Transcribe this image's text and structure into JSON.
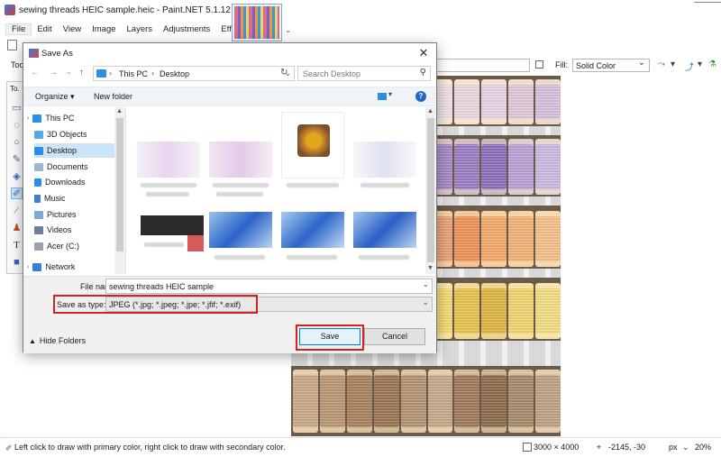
{
  "app": {
    "title": "sewing threads HEIC sample.heic - Paint.NET 5.1.12",
    "menu": [
      "File",
      "Edit",
      "View",
      "Image",
      "Layers",
      "Adjustments",
      "Effects"
    ],
    "tool_label": "Too",
    "fill_label": "Fill:",
    "fill_value": "Solid Color",
    "toolbox_label": "To."
  },
  "status": {
    "hint": "Left click to draw with primary color, right click to draw with secondary color.",
    "image_size": "3000 × 4000",
    "cursor_pos": "-2145, -30",
    "unit": "px",
    "zoom": "20%"
  },
  "dialog": {
    "title": "Save As",
    "breadcrumb": [
      "This PC",
      "Desktop"
    ],
    "search_placeholder": "Search Desktop",
    "organize_label": "Organize",
    "new_folder_label": "New folder",
    "nav_items": [
      {
        "label": "This PC",
        "icon": "computer-icon"
      },
      {
        "label": "3D Objects",
        "icon": "3d-objects-icon"
      },
      {
        "label": "Desktop",
        "icon": "desktop-icon",
        "selected": true
      },
      {
        "label": "Documents",
        "icon": "documents-icon"
      },
      {
        "label": "Downloads",
        "icon": "downloads-icon"
      },
      {
        "label": "Music",
        "icon": "music-icon"
      },
      {
        "label": "Pictures",
        "icon": "pictures-icon"
      },
      {
        "label": "Videos",
        "icon": "videos-icon"
      },
      {
        "label": "Acer (C:)",
        "icon": "drive-icon"
      },
      {
        "label": "Network",
        "icon": "network-icon"
      }
    ],
    "file_name_label": "File name:",
    "file_name_value": "sewing threads HEIC sample",
    "save_type_label": "Save as type:",
    "save_type_value": "JPEG (*.jpg; *.jpeg; *.jpe; *.jfif; *.exif)",
    "hide_folders_label": "Hide Folders",
    "save_label": "Save",
    "cancel_label": "Cancel"
  },
  "colors": {
    "accent": "#0078d7",
    "highlight_box": "#d92020",
    "selected_nav": "#cce4f7"
  }
}
